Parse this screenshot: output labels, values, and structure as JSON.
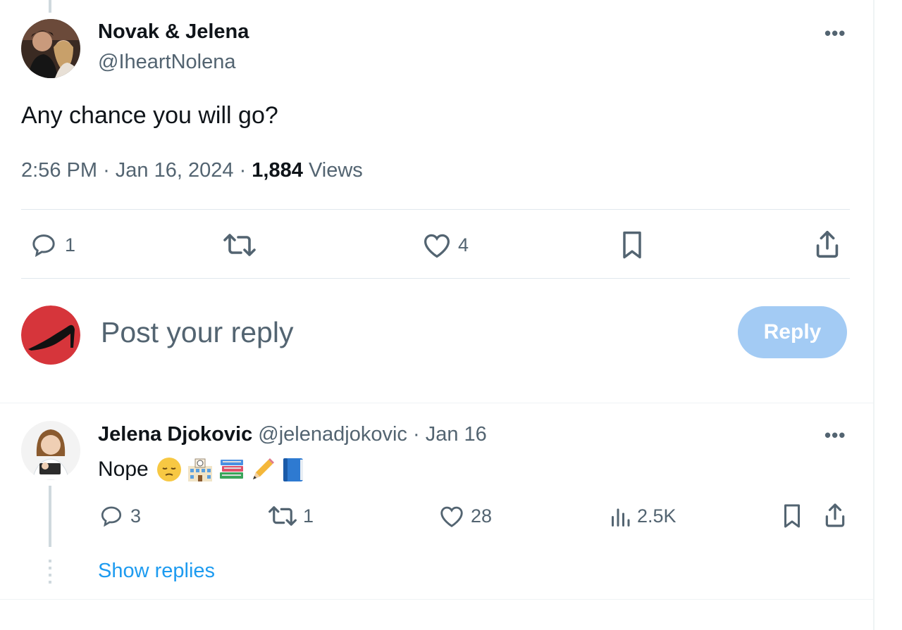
{
  "tweet": {
    "author_name": "Novak & Jelena",
    "author_handle": "@IheartNolena",
    "text": "Any chance you will go?",
    "time": "2:56 PM",
    "separator": "·",
    "date": "Jan 16, 2024",
    "views_count": "1,884",
    "views_label": "Views",
    "actions": {
      "replies": "1",
      "retweets": "",
      "likes": "4"
    }
  },
  "composer": {
    "placeholder": "Post your reply",
    "button_label": "Reply"
  },
  "reply": {
    "author_name": "Jelena Djokovic",
    "author_handle": "@jelenadjokovic",
    "separator": "·",
    "date": "Jan 16",
    "text": "Nope",
    "emojis": [
      "pensive-face-emoji",
      "school-emoji",
      "books-emoji",
      "pencil-emoji",
      "blue-book-emoji"
    ],
    "actions": {
      "replies": "3",
      "retweets": "1",
      "likes": "28",
      "views": "2.5K"
    },
    "show_replies": "Show replies"
  },
  "colors": {
    "text": "#0f1419",
    "secondary": "#536471",
    "link": "#1d9bf0",
    "reply_button": "#a3cbf4",
    "composer_avatar": "#d6353b"
  }
}
